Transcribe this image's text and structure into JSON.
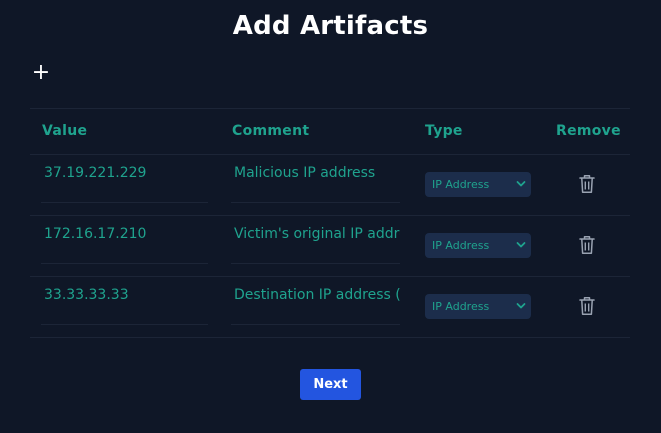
{
  "page": {
    "title": "Add Artifacts"
  },
  "toolbar": {
    "add_icon": "plus-icon",
    "add_symbol": "+"
  },
  "table": {
    "headers": [
      "Value",
      "Comment",
      "Type",
      "Remove"
    ],
    "rows": [
      {
        "value": "37.19.221.229",
        "comment": "Malicious IP address",
        "type": "IP Address",
        "remove_icon": "trash-icon"
      },
      {
        "value": "172.16.17.210",
        "comment": "Victim's original IP address",
        "type": "IP Address",
        "remove_icon": "trash-icon"
      },
      {
        "value": "33.33.33.33",
        "comment": "Destination IP address (",
        "type": "IP Address",
        "remove_icon": "trash-icon"
      }
    ]
  },
  "footer": {
    "next_label": "Next"
  },
  "colors": {
    "background": "#0f1727",
    "accent_teal": "#1fa38e",
    "select_bg": "#1c2d4b",
    "primary_button": "#2355e0",
    "divider": "#1c2537"
  }
}
